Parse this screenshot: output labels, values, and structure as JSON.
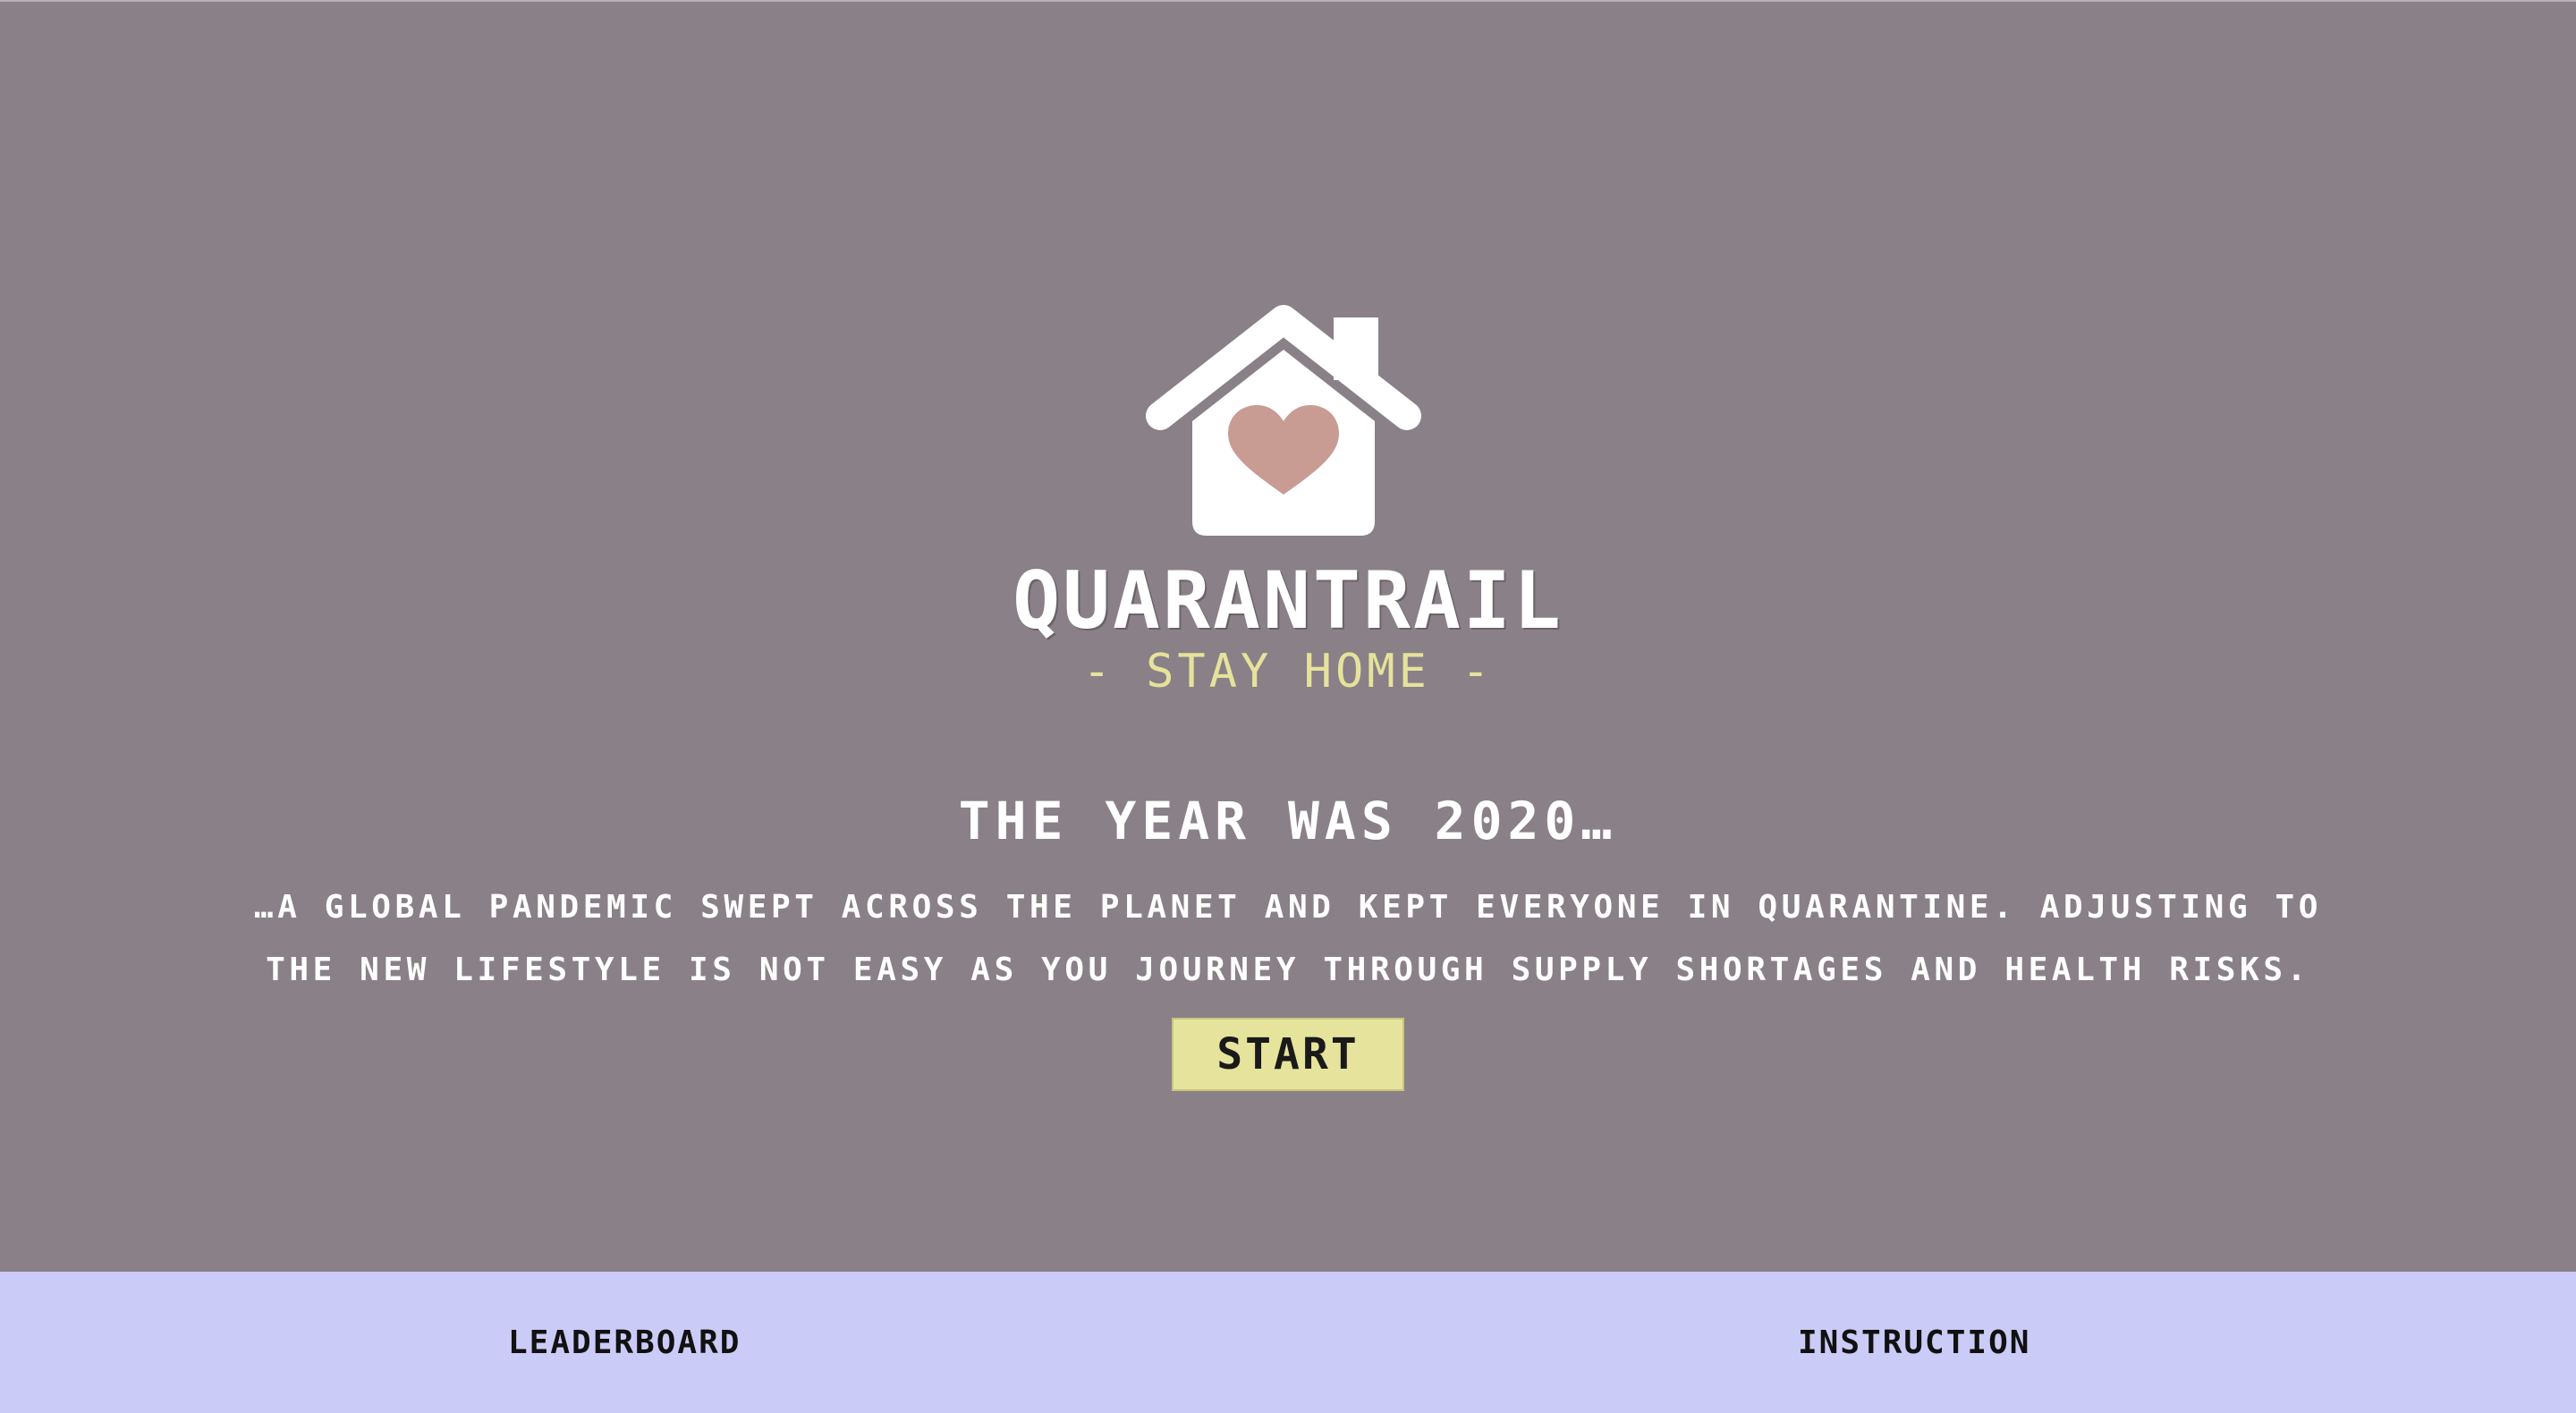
{
  "colors": {
    "background": "#8a8087",
    "accent": "#e6e39c",
    "subtitle": "#e7e29b",
    "heart": "#c89b93",
    "footer": "#cbcbf8",
    "text": "#ffffff"
  },
  "logo": {
    "icon": "house-heart-icon"
  },
  "hero": {
    "title": "QUARANTRAIL",
    "subtitle": "- STAY HOME -",
    "heading": "THE YEAR WAS 2020…",
    "story_line1": "…A GLOBAL PANDEMIC SWEPT ACROSS THE PLANET AND KEPT EVERYONE IN QUARANTINE. ADJUSTING TO",
    "story_line2": "THE NEW LIFESTYLE IS NOT EASY AS YOU JOURNEY THROUGH SUPPLY SHORTAGES AND HEALTH RISKS.",
    "start_label": "START"
  },
  "footer": {
    "leaderboard_label": "LEADERBOARD",
    "instruction_label": "INSTRUCTION"
  }
}
